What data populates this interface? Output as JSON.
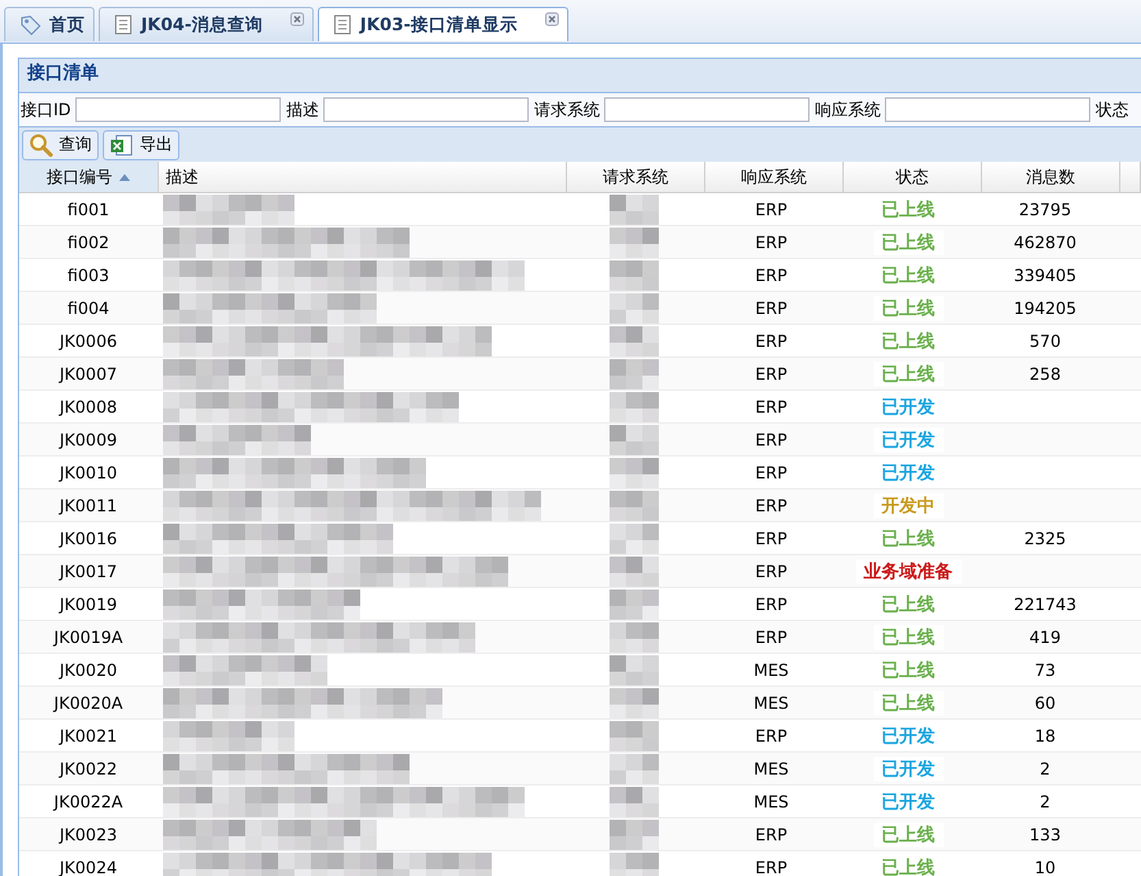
{
  "tabs": [
    {
      "label": "首页",
      "kind": "home",
      "closable": false,
      "selected": false
    },
    {
      "label": "JK04-消息查询",
      "kind": "page",
      "closable": true,
      "selected": false
    },
    {
      "label": "JK03-接口清单显示",
      "kind": "page",
      "closable": true,
      "selected": true
    }
  ],
  "panel": {
    "title": "接口清单"
  },
  "filters": [
    {
      "label": "接口ID"
    },
    {
      "label": "描述"
    },
    {
      "label": "请求系统"
    },
    {
      "label": "响应系统"
    },
    {
      "label": "状态"
    }
  ],
  "toolbar": [
    {
      "label": "查询",
      "kind": "search"
    },
    {
      "label": "导出",
      "kind": "export"
    }
  ],
  "table": {
    "columns": [
      {
        "label": "接口编号",
        "sorted": true
      },
      {
        "label": "描述",
        "sorted": false
      },
      {
        "label": "请求系统",
        "sorted": false
      },
      {
        "label": "响应系统",
        "sorted": false
      },
      {
        "label": "状态",
        "sorted": false
      },
      {
        "label": "消息数",
        "sorted": false
      }
    ],
    "rows": [
      {
        "id": "fi001",
        "response": "ERP",
        "status": "已上线",
        "color": "#6ab04c",
        "count": "23795"
      },
      {
        "id": "fi002",
        "response": "ERP",
        "status": "已上线",
        "color": "#6ab04c",
        "count": "462870"
      },
      {
        "id": "fi003",
        "response": "ERP",
        "status": "已上线",
        "color": "#6ab04c",
        "count": "339405"
      },
      {
        "id": "fi004",
        "response": "ERP",
        "status": "已上线",
        "color": "#6ab04c",
        "count": "194205"
      },
      {
        "id": "JK0006",
        "response": "ERP",
        "status": "已上线",
        "color": "#6ab04c",
        "count": "570"
      },
      {
        "id": "JK0007",
        "response": "ERP",
        "status": "已上线",
        "color": "#6ab04c",
        "count": "258"
      },
      {
        "id": "JK0008",
        "response": "ERP",
        "status": "已开发",
        "color": "#1aa5e0"
      },
      {
        "id": "JK0009",
        "response": "ERP",
        "status": "已开发",
        "color": "#1aa5e0"
      },
      {
        "id": "JK0010",
        "response": "ERP",
        "status": "已开发",
        "color": "#1aa5e0"
      },
      {
        "id": "JK0011",
        "response": "ERP",
        "status": "开发中",
        "color": "#c99a1e"
      },
      {
        "id": "JK0016",
        "response": "ERP",
        "status": "已上线",
        "color": "#6ab04c",
        "count": "2325"
      },
      {
        "id": "JK0017",
        "response": "ERP",
        "status": "业务域准备",
        "color": "#cc1a1a"
      },
      {
        "id": "JK0019",
        "response": "ERP",
        "status": "已上线",
        "color": "#6ab04c",
        "count": "221743"
      },
      {
        "id": "JK0019A",
        "response": "ERP",
        "status": "已上线",
        "color": "#6ab04c",
        "count": "419"
      },
      {
        "id": "JK0020",
        "response": "MES",
        "status": "已上线",
        "color": "#6ab04c",
        "count": "73"
      },
      {
        "id": "JK0020A",
        "response": "MES",
        "status": "已上线",
        "color": "#6ab04c",
        "count": "60"
      },
      {
        "id": "JK0021",
        "response": "ERP",
        "status": "已开发",
        "color": "#1aa5e0",
        "count": "18"
      },
      {
        "id": "JK0022",
        "response": "MES",
        "status": "已开发",
        "color": "#1aa5e0",
        "count": "2"
      },
      {
        "id": "JK0022A",
        "response": "MES",
        "status": "已开发",
        "color": "#1aa5e0",
        "count": "2"
      },
      {
        "id": "JK0023",
        "response": "ERP",
        "status": "已上线",
        "color": "#6ab04c",
        "count": "133"
      },
      {
        "id": "JK0024",
        "response": "ERP",
        "status": "已上线",
        "color": "#6ab04c",
        "count": "10"
      }
    ]
  }
}
